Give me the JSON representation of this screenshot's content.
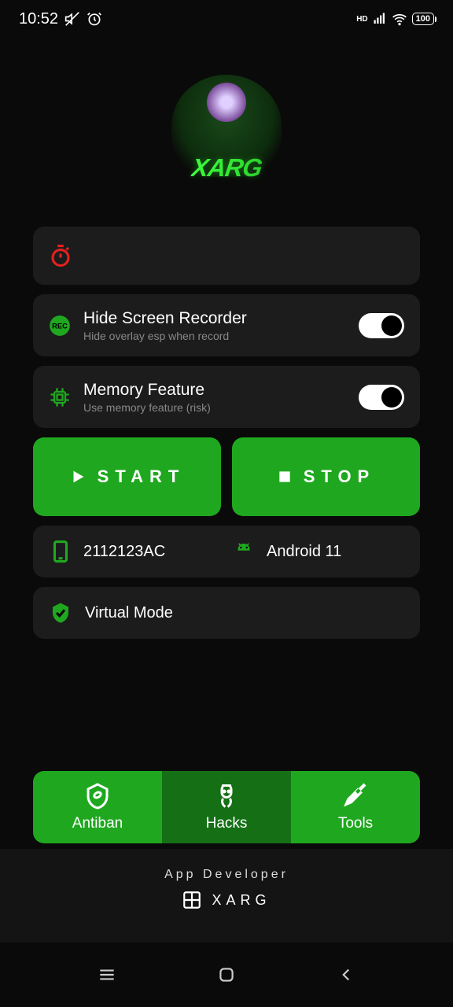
{
  "status": {
    "time": "10:52",
    "battery": "100",
    "hd": "HD"
  },
  "logo": {
    "text": "XARG"
  },
  "timer_card": {},
  "options": [
    {
      "title": "Hide Screen Recorder",
      "subtitle": "Hide overlay esp when record"
    },
    {
      "title": "Memory Feature",
      "subtitle": "Use memory feature (risk)"
    }
  ],
  "buttons": {
    "start": "START",
    "stop": "STOP"
  },
  "device": {
    "model": "2112123AC",
    "os": "Android 11"
  },
  "mode": {
    "label": "Virtual Mode"
  },
  "tabs": [
    {
      "label": "Antiban"
    },
    {
      "label": "Hacks"
    },
    {
      "label": "Tools"
    }
  ],
  "footer": {
    "title": "App Developer",
    "brand": "XARG"
  }
}
